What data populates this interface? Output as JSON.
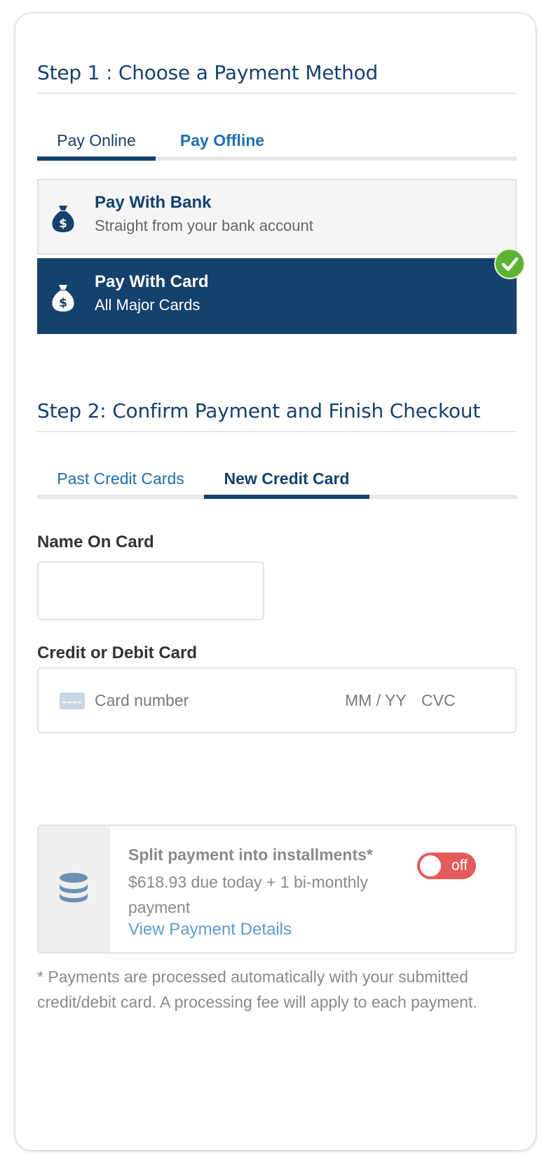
{
  "step1": {
    "title": "Step 1 : Choose a Payment Method",
    "tabs": [
      {
        "label": "Pay Online",
        "active": true
      },
      {
        "label": "Pay Offline",
        "active": false
      }
    ],
    "options": [
      {
        "title": "Pay With Bank",
        "subtitle": "Straight from your bank account",
        "selected": false,
        "icon": "money-bag-icon"
      },
      {
        "title": "Pay With Card",
        "subtitle": "All Major Cards",
        "selected": true,
        "icon": "money-bag-icon"
      }
    ]
  },
  "step2": {
    "title": "Step 2: Confirm Payment and Finish Checkout",
    "tabs": [
      {
        "label": "Past Credit Cards",
        "active": false
      },
      {
        "label": "New Credit Card",
        "active": true
      }
    ],
    "name_label": "Name On Card",
    "name_value": "",
    "card_label": "Credit or Debit Card",
    "card_placeholder": "Card number",
    "exp_placeholder": "MM / YY",
    "cvc_placeholder": "CVC"
  },
  "installments": {
    "title": "Split payment into installments*",
    "description": "$618.93 due today + 1 bi-monthly payment",
    "link": "View Payment Details",
    "toggle_label": "off",
    "icon": "coins-stack-icon"
  },
  "footnote": "* Payments are processed automatically with your submitted credit/debit card. A processing fee will apply to each payment.",
  "colors": {
    "primary": "#15416d",
    "link": "#1f6fb2",
    "success": "#5fb332",
    "toggle_off": "#e45b5b"
  }
}
